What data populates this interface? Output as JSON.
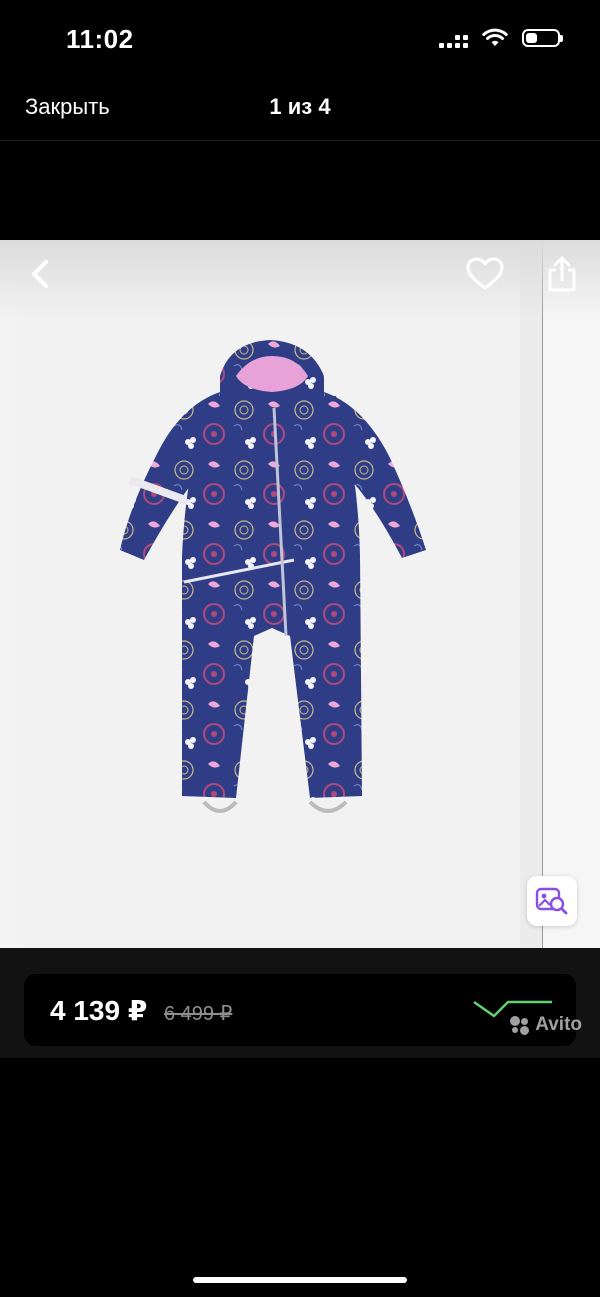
{
  "status_bar": {
    "time": "11:02",
    "battery_level": 0.35
  },
  "nav": {
    "close_label": "Закрыть",
    "page_counter": "1 из 4"
  },
  "photo": {
    "back_icon": "chevron-left-icon",
    "favorite_icon": "heart-icon",
    "share_icon": "share-icon",
    "image_search_icon": "image-search-icon",
    "product_image": "children-winter-jumpsuit-navy-floral"
  },
  "price": {
    "current": "4 139 ₽",
    "old": "6 499 ₽",
    "trend_color": "#5fd36f"
  },
  "watermark": {
    "text": "Avito"
  },
  "colors": {
    "accent_purple": "#8a4fe0",
    "background": "#000000"
  }
}
